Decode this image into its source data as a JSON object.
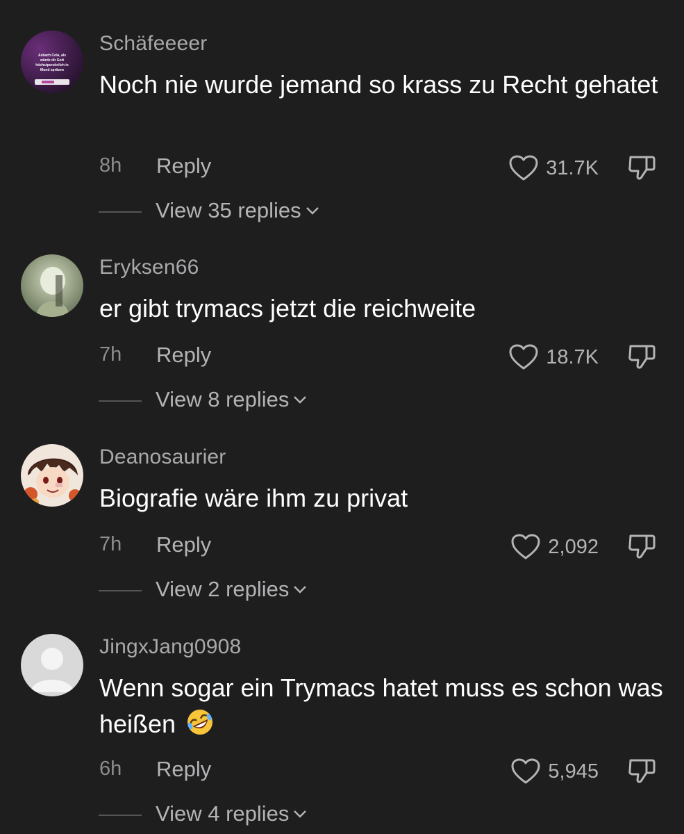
{
  "comments": [
    {
      "username": "Schäfeeeer",
      "text": "Noch nie wurde jemand so krass zu Recht gehatet",
      "avatar_icon": "meme-screenshot-avatar",
      "avatar_text": [
        "Asbach Cola, als",
        "würde dir Gott",
        "höchstpersönlich in",
        "Mund spritzen"
      ],
      "time": "8h",
      "reply_label": "Reply",
      "likes": "31.7K",
      "view_replies": "View 35 replies"
    },
    {
      "username": "Eryksen66",
      "text": "er gibt trymacs jetzt die reichweite",
      "avatar_icon": "ghost-photo-avatar",
      "time": "7h",
      "reply_label": "Reply",
      "likes": "18.7K",
      "view_replies": "View 8 replies"
    },
    {
      "username": "Deanosaurier",
      "text": "Biografie wäre ihm zu privat",
      "avatar_icon": "anime-character-avatar",
      "time": "7h",
      "reply_label": "Reply",
      "likes": "2,092",
      "view_replies": "View 2 replies"
    },
    {
      "username": "JingxJang0908",
      "text": "Wenn sogar ein Trymacs hatet muss es schon was heißen",
      "emoji": "rolling-on-floor-laughing",
      "avatar_icon": "default-user-avatar",
      "time": "6h",
      "reply_label": "Reply",
      "likes": "5,945",
      "view_replies": "View 4 replies"
    }
  ],
  "colors": {
    "background": "#1e1e1f",
    "username": "#a9a9ab",
    "text": "#ffffff",
    "secondary": "#b4b4b6"
  }
}
